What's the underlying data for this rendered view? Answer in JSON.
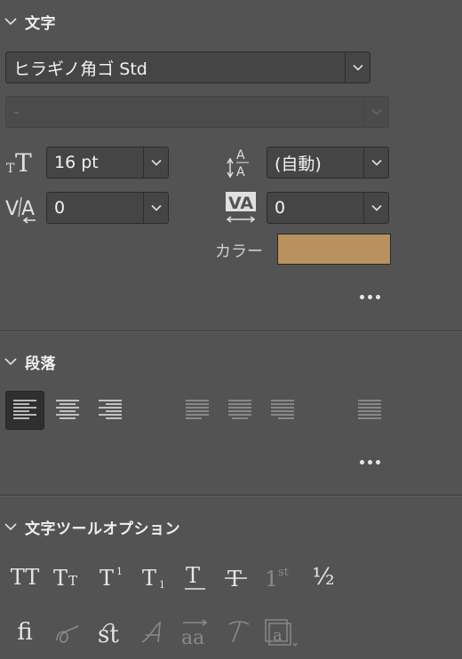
{
  "character": {
    "title": "文字",
    "font_family": "ヒラギノ角ゴ Std",
    "font_style": "-",
    "font_size": "16 pt",
    "leading": "(自動)",
    "kerning": "0",
    "tracking": "0",
    "color_label": "カラー",
    "color_value": "#B8915E"
  },
  "paragraph": {
    "title": "段落",
    "alignments": [
      "align-left",
      "align-center",
      "align-right",
      "justify-last-left",
      "justify-last-center",
      "justify-last-right",
      "justify-all"
    ],
    "active": "align-left"
  },
  "type_tools": {
    "title": "文字ツールオプション",
    "row1": [
      {
        "name": "all-caps",
        "text": "TT"
      },
      {
        "name": "small-caps",
        "text": "Tт"
      },
      {
        "name": "superscript",
        "text": "T¹"
      },
      {
        "name": "subscript",
        "text": "T₁"
      },
      {
        "name": "underline",
        "text": "T"
      },
      {
        "name": "strikethrough",
        "text": "T"
      },
      {
        "name": "ordinals",
        "text": "1st"
      },
      {
        "name": "fractions",
        "text": "½"
      }
    ],
    "row2": [
      {
        "name": "standard-ligatures",
        "text": "fi"
      },
      {
        "name": "contextual-alternates",
        "text": "ơ"
      },
      {
        "name": "discretionary-ligatures",
        "text": "st"
      },
      {
        "name": "swash",
        "text": "𝒜"
      },
      {
        "name": "stylistic-alternates",
        "text": "aa"
      },
      {
        "name": "titling-alternates",
        "text": "T"
      },
      {
        "name": "stylistic-sets",
        "text": "a"
      }
    ]
  }
}
